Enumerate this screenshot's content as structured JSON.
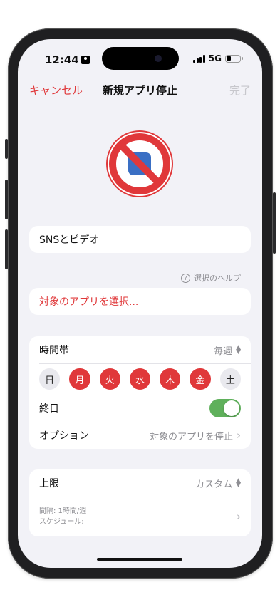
{
  "status": {
    "time": "12:44",
    "network": "5G"
  },
  "nav": {
    "cancel": "キャンセル",
    "title": "新規アプリ停止",
    "done": "完了"
  },
  "name_field": {
    "value": "SNSとビデオ"
  },
  "help": {
    "icon": "?",
    "label": "選択のヘルプ"
  },
  "select_apps": {
    "label": "対象のアプリを選択..."
  },
  "schedule": {
    "time_label": "時間帯",
    "frequency": "毎週",
    "days": [
      {
        "label": "日",
        "selected": false
      },
      {
        "label": "月",
        "selected": true
      },
      {
        "label": "火",
        "selected": true
      },
      {
        "label": "水",
        "selected": true
      },
      {
        "label": "木",
        "selected": true
      },
      {
        "label": "金",
        "selected": true
      },
      {
        "label": "土",
        "selected": false
      }
    ],
    "all_day_label": "終日",
    "all_day_on": true,
    "options_label": "オプション",
    "options_value": "対象のアプリを停止"
  },
  "limit": {
    "label": "上限",
    "value": "カスタム",
    "interval": "間隔: 1時間/週",
    "schedule": "スケジュール:"
  },
  "colors": {
    "accent_red": "#e0383a",
    "toggle_green": "#5fb05b",
    "background": "#f2f2f7"
  }
}
